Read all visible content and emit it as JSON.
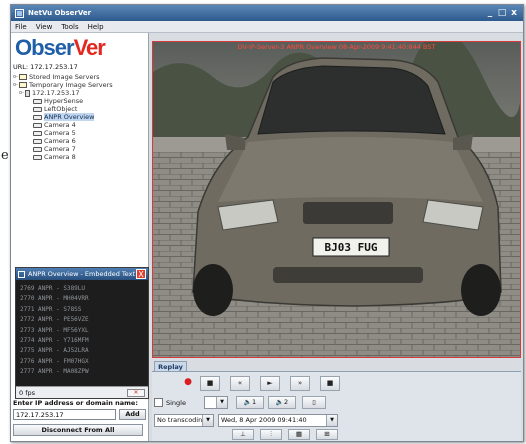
{
  "background_fragment": "e.",
  "window": {
    "title": "NetVu ObserVer",
    "min": "_",
    "max": "□",
    "close": "x"
  },
  "menu": [
    "File",
    "View",
    "Tools",
    "Help"
  ],
  "logo": {
    "part1": "Obser",
    "part2": "Ver"
  },
  "url_line": "URL: 172.17.253.17",
  "tree": {
    "stored": "Stored Image Servers",
    "temporary": "Temporary Image Servers",
    "server": "172.17.253.17",
    "cameras": [
      "HyperSense",
      "LeftObject",
      "ANPR Overview",
      "Camera 4",
      "Camera 5",
      "Camera 6",
      "Camera 7",
      "Camera 8"
    ],
    "selected_index": 2
  },
  "popup": {
    "title": "ANPR Overview - Embedded Text",
    "close": "X",
    "lines": [
      "2769 ANPR - S389LU",
      "2770 ANPR - MH04VRR",
      "2771 ANPR - S78SS",
      "2772 ANPR - PE56VZE",
      "2773 ANPR - MF56YXL",
      "2774 ANPR - Y716MFM",
      "2775 ANPR - AJ52LRA",
      "2776 ANPR - FM07HGX",
      "2777 ANPR - MA08ZPW"
    ],
    "fps": "0 fps",
    "clear_icon": "trash-icon"
  },
  "ip": {
    "label": "Enter IP address or domain name:",
    "value": "172.17.253.17",
    "add": "Add",
    "disconnect": "Disconnect From All"
  },
  "video": {
    "caption": "DV-IP-Server-3 ANPR Overview 08-Apr-2009 9:41:40:844 BST",
    "plate": "BJ03 FUG",
    "border_color": "#d63a3a"
  },
  "replay": {
    "tab": "Replay",
    "transport": [
      "●",
      "■",
      "«",
      "►",
      "»",
      "■"
    ],
    "single_label": "Single",
    "audio1": "🔈1",
    "audio2": "🔈2",
    "transcode": "No transcodin...",
    "datetime": "Wed, 8 Apr 2009 09:41:40",
    "bottom_icons": [
      "ptz-icon",
      "chart-icon",
      "grid-icon",
      "layout-icon"
    ]
  }
}
